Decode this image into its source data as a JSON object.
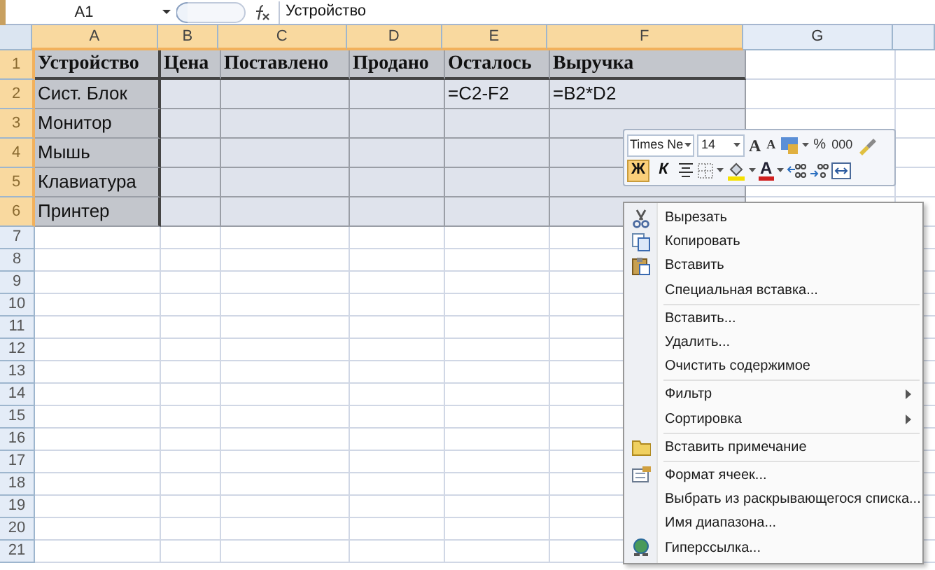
{
  "formula_bar": {
    "name_box": "A1",
    "formula": "Устройство"
  },
  "columns": [
    {
      "label": "A",
      "selected": true
    },
    {
      "label": "B",
      "selected": true
    },
    {
      "label": "C",
      "selected": true
    },
    {
      "label": "D",
      "selected": true
    },
    {
      "label": "E",
      "selected": true
    },
    {
      "label": "F",
      "selected": true
    },
    {
      "label": "G",
      "selected": false
    }
  ],
  "rows": [
    {
      "label": "1",
      "selected": true,
      "cells": [
        "Устройство",
        "Цена",
        "Поставлено",
        "Продано",
        "Осталось",
        "Выручка"
      ]
    },
    {
      "label": "2",
      "selected": true,
      "cells": [
        "Сист. Блок",
        "",
        "",
        "",
        "=C2-F2",
        "=B2*D2"
      ]
    },
    {
      "label": "3",
      "selected": true,
      "cells": [
        "Монитор"
      ]
    },
    {
      "label": "4",
      "selected": true,
      "cells": [
        "Мышь"
      ]
    },
    {
      "label": "5",
      "selected": true,
      "cells": [
        "Клавиатура"
      ]
    },
    {
      "label": "6",
      "selected": true,
      "cells": [
        "Принтер"
      ]
    },
    {
      "label": "7",
      "selected": false
    },
    {
      "label": "8",
      "selected": false
    },
    {
      "label": "9",
      "selected": false
    },
    {
      "label": "10",
      "selected": false
    },
    {
      "label": "11",
      "selected": false
    },
    {
      "label": "12",
      "selected": false
    },
    {
      "label": "13",
      "selected": false
    },
    {
      "label": "14",
      "selected": false
    },
    {
      "label": "15",
      "selected": false
    },
    {
      "label": "16",
      "selected": false
    },
    {
      "label": "17",
      "selected": false
    },
    {
      "label": "18",
      "selected": false
    },
    {
      "label": "19",
      "selected": false
    },
    {
      "label": "20",
      "selected": false
    },
    {
      "label": "21",
      "selected": false
    }
  ],
  "mini_toolbar": {
    "font": "Times Ne",
    "size": "14",
    "grow_font": "A",
    "shrink_font": "A",
    "percent": "%",
    "thousands": "000",
    "bold": {
      "label": "Ж",
      "selected": true
    },
    "italic": {
      "label": "К",
      "selected": false
    },
    "font_color": "A"
  },
  "context_menu": [
    {
      "label": "Вырезать",
      "separator_before": false,
      "submenu": false
    },
    {
      "label": "Копировать",
      "separator_before": false,
      "submenu": false
    },
    {
      "label": "Вставить",
      "separator_before": false,
      "submenu": false
    },
    {
      "label": "Специальная вставка...",
      "separator_before": false,
      "submenu": false
    },
    {
      "label": "Вставить...",
      "separator_before": true,
      "submenu": false
    },
    {
      "label": "Удалить...",
      "separator_before": false,
      "submenu": false
    },
    {
      "label": "Очистить содержимое",
      "separator_before": false,
      "submenu": false
    },
    {
      "label": "Фильтр",
      "separator_before": true,
      "submenu": true
    },
    {
      "label": "Сортировка",
      "separator_before": false,
      "submenu": true
    },
    {
      "label": "Вставить примечание",
      "separator_before": true,
      "submenu": false
    },
    {
      "label": "Формат ячеек...",
      "separator_before": true,
      "submenu": false
    },
    {
      "label": "Выбрать из раскрывающегося списка...",
      "separator_before": false,
      "submenu": false
    },
    {
      "label": "Имя диапазона...",
      "separator_before": false,
      "submenu": false
    },
    {
      "label": "Гиперссылка...",
      "separator_before": false,
      "submenu": false
    }
  ]
}
